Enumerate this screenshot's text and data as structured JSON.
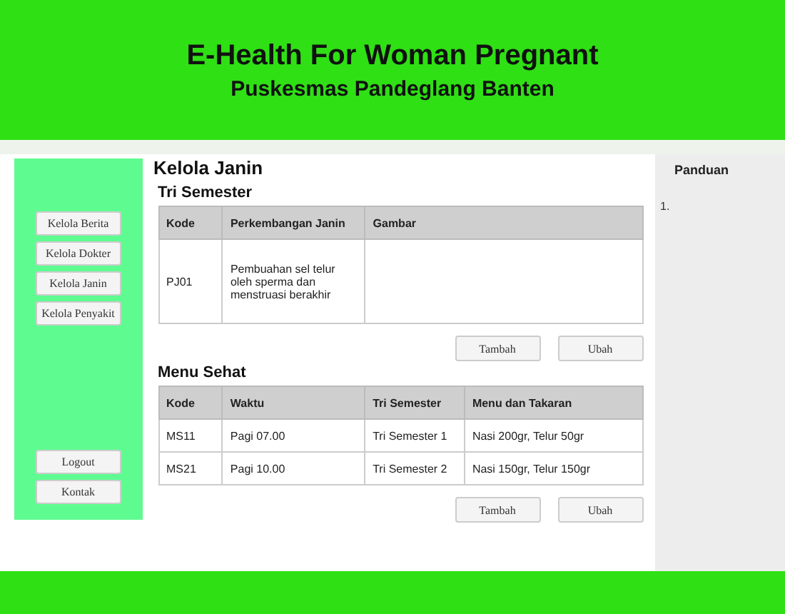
{
  "header": {
    "title": "E-Health For Woman Pregnant",
    "subtitle": "Puskesmas Pandeglang Banten"
  },
  "sidebar": {
    "menu": [
      "Kelola Berita",
      "Kelola Dokter",
      "Kelola Janin",
      "Kelola Penyakit"
    ],
    "bottom": [
      "Logout",
      "Kontak"
    ]
  },
  "page_title": "Kelola Janin",
  "sections": [
    {
      "title": "Tri Semester",
      "columns": [
        "Kode",
        "Perkembangan Janin",
        "Gambar"
      ],
      "rows": [
        [
          "PJ01",
          "Pembuahan sel telur oleh sperma dan menstruasi berakhir",
          ""
        ]
      ],
      "buttons": [
        "Tambah",
        "Ubah"
      ]
    },
    {
      "title": "Menu Sehat",
      "columns": [
        "Kode",
        "Waktu",
        "Tri Semester",
        "Menu dan Takaran"
      ],
      "rows": [
        [
          "MS11",
          "Pagi 07.00",
          "Tri Semester 1",
          "Nasi 200gr, Telur 50gr"
        ],
        [
          "MS21",
          "Pagi 10.00",
          "Tri Semester 2",
          "Nasi 150gr, Telur 150gr"
        ]
      ],
      "buttons": [
        "Tambah",
        "Ubah"
      ]
    }
  ],
  "guide": {
    "title": "Panduan",
    "items": [
      "1."
    ]
  }
}
